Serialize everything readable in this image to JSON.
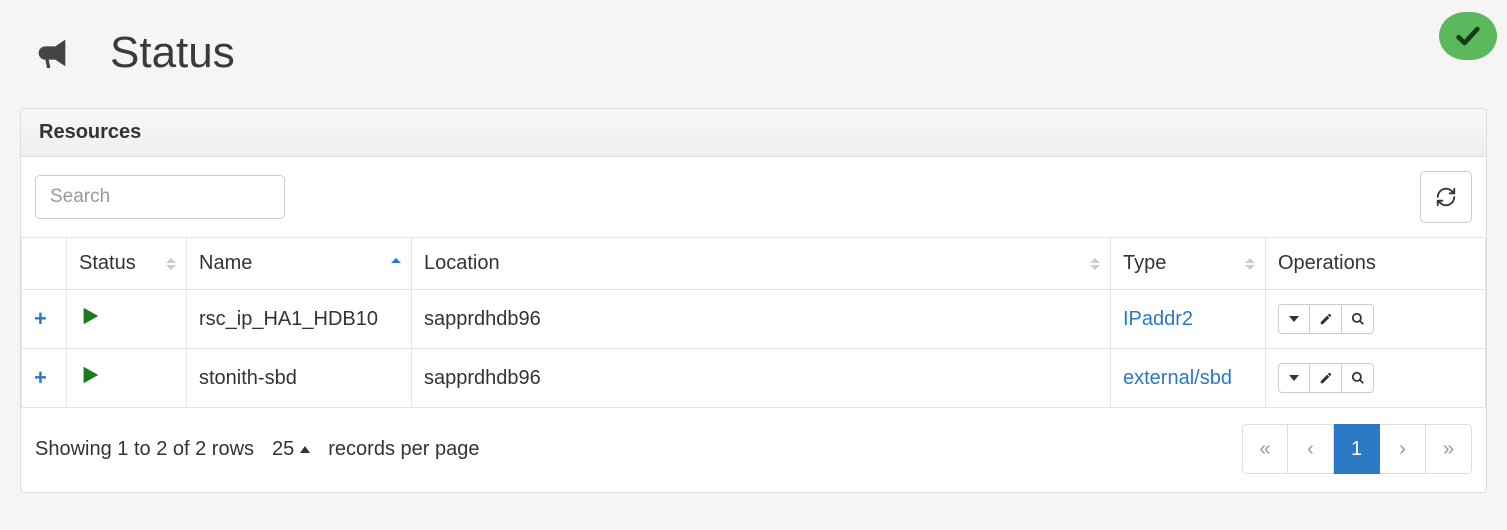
{
  "page": {
    "title": "Status",
    "status_icon": "ok"
  },
  "panel": {
    "heading": "Resources"
  },
  "search": {
    "placeholder": "Search",
    "value": ""
  },
  "columns": {
    "status": "Status",
    "name": "Name",
    "location": "Location",
    "type": "Type",
    "operations": "Operations"
  },
  "rows": [
    {
      "name": "rsc_ip_HA1_HDB10",
      "location": "sapprdhdb96",
      "type": "IPaddr2"
    },
    {
      "name": "stonith-sbd",
      "location": "sapprdhdb96",
      "type": "external/sbd"
    }
  ],
  "footer": {
    "summary": "Showing 1 to 2 of 2 rows",
    "page_size": "25",
    "records_label": "records per page"
  },
  "pagination": {
    "first": "«",
    "prev": "‹",
    "current": "1",
    "next": "›",
    "last": "»"
  }
}
